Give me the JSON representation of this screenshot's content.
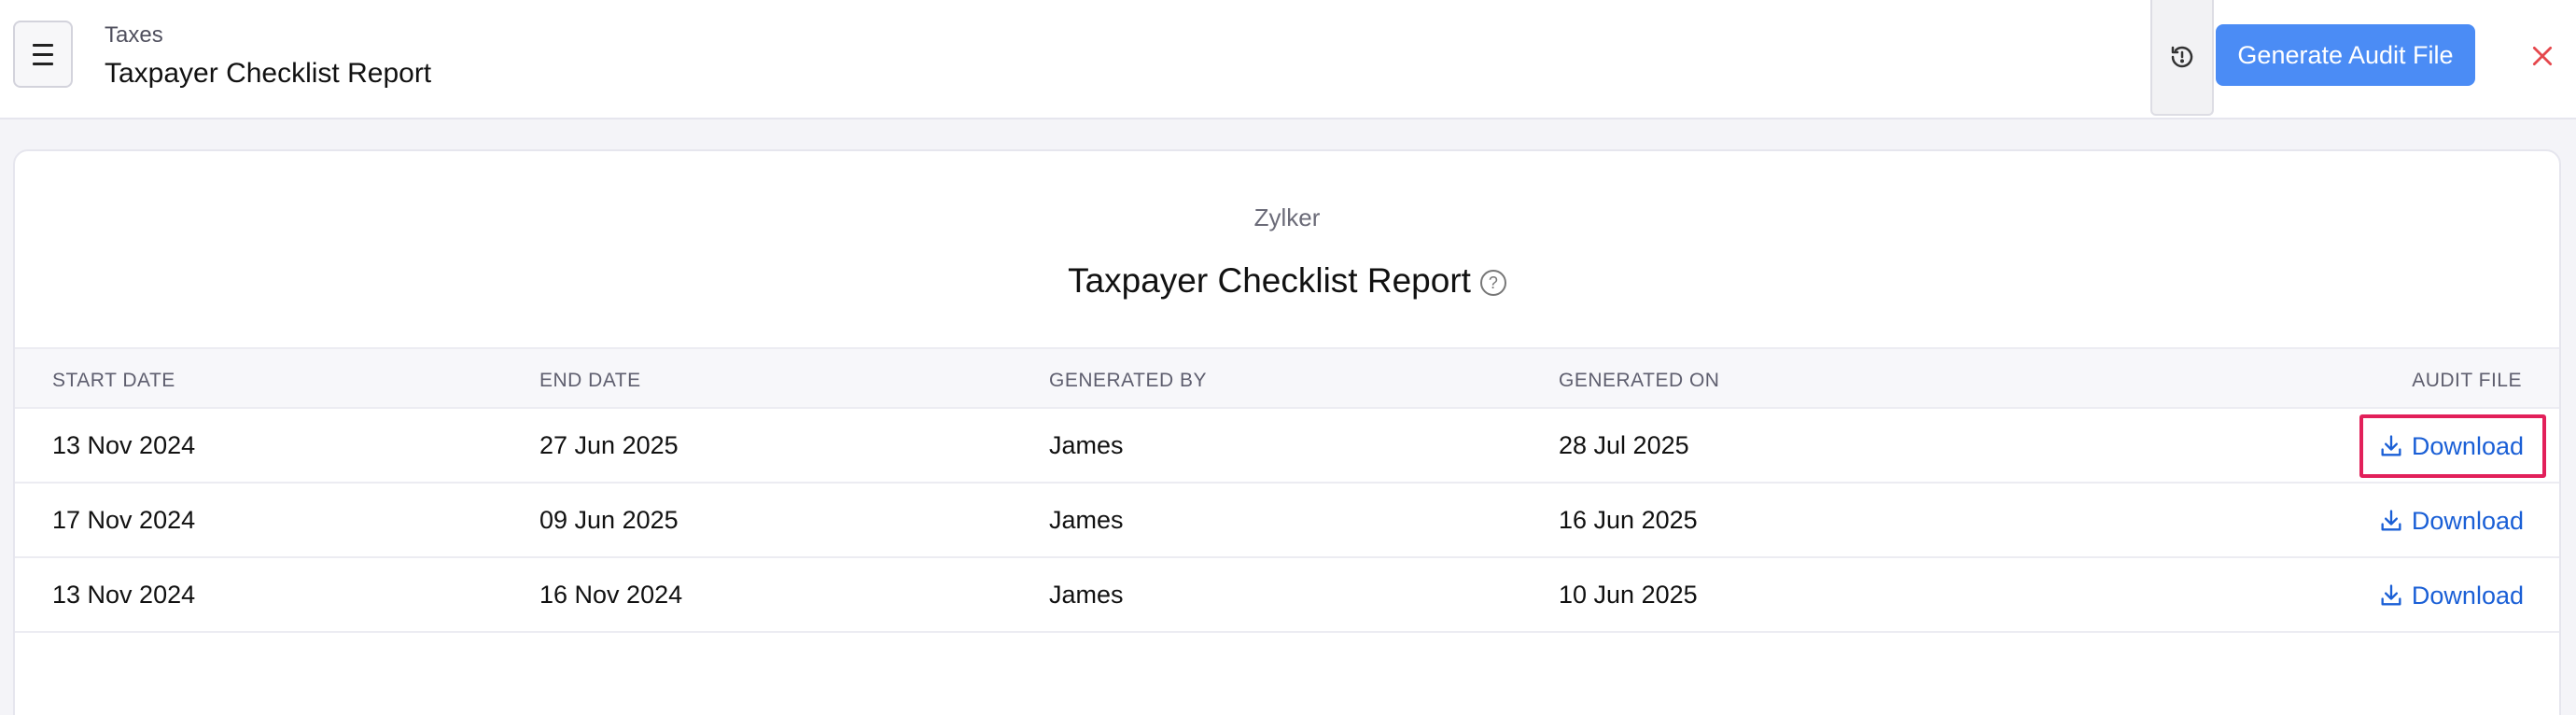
{
  "header": {
    "breadcrumb": "Taxes",
    "title": "Taxpayer Checklist Report",
    "menu_icon": "hamburger-icon",
    "history_icon": "history-icon",
    "generate_label": "Generate Audit File",
    "close_icon": "close-icon"
  },
  "report": {
    "org_name": "Zylker",
    "title": "Taxpayer Checklist Report",
    "help_icon": "help-icon",
    "help_glyph": "?"
  },
  "table": {
    "columns": [
      "START DATE",
      "END DATE",
      "GENERATED BY",
      "GENERATED ON",
      "AUDIT FILE"
    ],
    "rows": [
      {
        "start": "13 Nov 2024",
        "end": "27 Jun 2025",
        "by": "James",
        "on": "28 Jul 2025",
        "file": "Download"
      },
      {
        "start": "17 Nov 2024",
        "end": "09 Jun 2025",
        "by": "James",
        "on": "16 Jun 2025",
        "file": "Download"
      },
      {
        "start": "13 Nov 2024",
        "end": "16 Nov 2024",
        "by": "James",
        "on": "10 Jun 2025",
        "file": "Download"
      }
    ]
  },
  "colors": {
    "accent": "#4b8cf5",
    "link": "#1a5fd6",
    "close": "#e5484d",
    "highlight": "#e2205a"
  }
}
